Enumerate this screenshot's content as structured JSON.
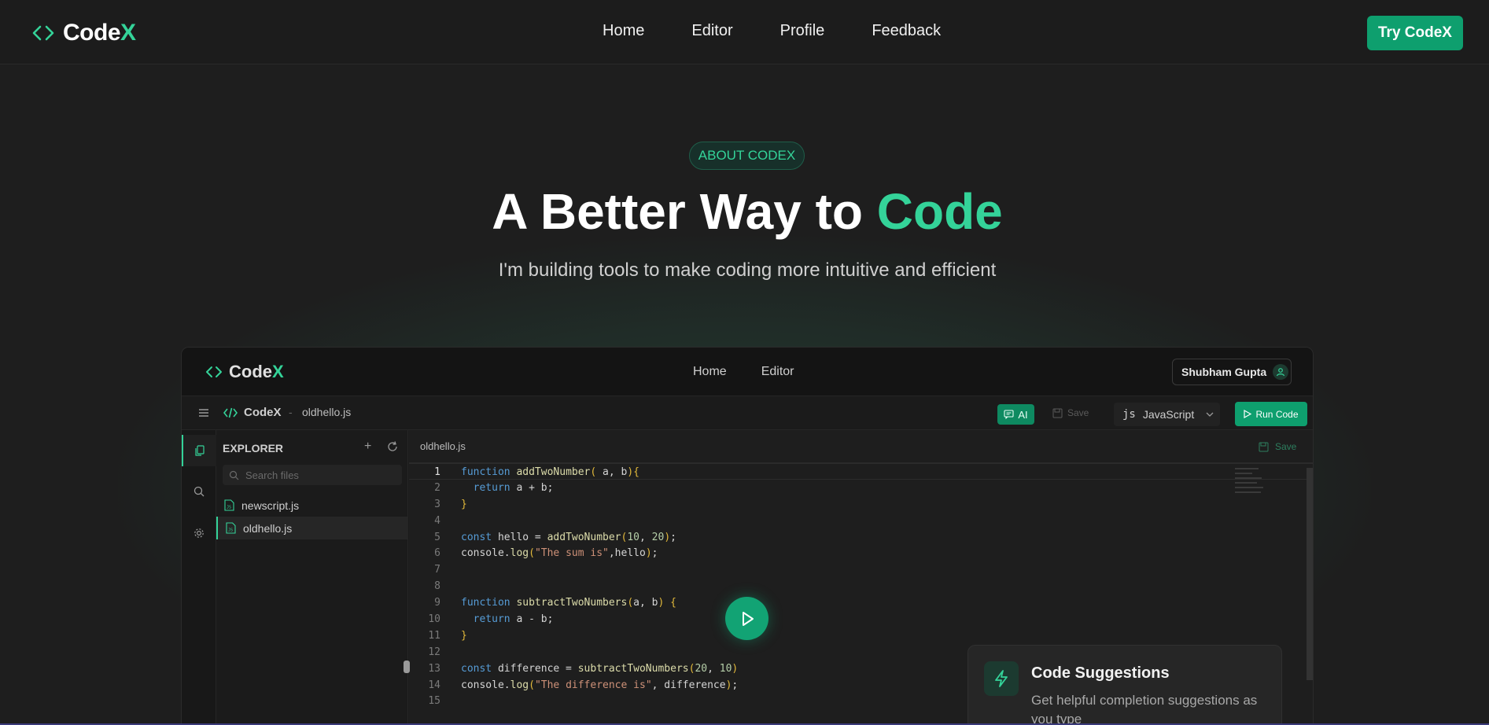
{
  "nav": {
    "brand_prefix": "Code",
    "brand_suffix": "X",
    "links": [
      "Home",
      "Editor",
      "Profile",
      "Feedback"
    ],
    "cta": "Try CodeX"
  },
  "hero": {
    "badge": "ABOUT CODEX",
    "title_main": "A Better Way to ",
    "title_accent": "Code",
    "subtitle": "I'm building tools to make coding more intuitive and efficient"
  },
  "mockup": {
    "nav": {
      "brand_prefix": "Code",
      "brand_suffix": "X",
      "links": [
        "Home",
        "Editor"
      ],
      "user_name": "Shubham Gupta"
    },
    "toolbar": {
      "brand": "CodeX",
      "separator": "-",
      "file": "oldhello.js",
      "ai_label": "AI",
      "save_label": "Save",
      "lang_icon": "js",
      "language": "JavaScript",
      "run_label": "Run Code"
    },
    "explorer": {
      "title": "EXPLORER",
      "search_placeholder": "Search files",
      "files": [
        "newscript.js",
        "oldhello.js"
      ],
      "active_file": "oldhello.js"
    },
    "editor": {
      "tab": "oldhello.js",
      "save_label": "Save",
      "line_numbers": [
        "1",
        "2",
        "3",
        "4",
        "5",
        "6",
        "7",
        "8",
        "9",
        "10",
        "11",
        "12",
        "13",
        "14",
        "15"
      ],
      "code_lines": [
        "function addTwoNumber( a, b){",
        "  return a + b;",
        "}",
        "",
        "const hello = addTwoNumber(10, 20);",
        "console.log(\"The sum is\",hello);",
        "",
        "",
        "function subtractTwoNumbers(a, b) {",
        "  return a - b;",
        "}",
        "",
        "const difference = subtractTwoNumbers(20, 10)",
        "console.log(\"The difference is\", difference);",
        ""
      ]
    }
  },
  "feature_card": {
    "icon": "lightning-icon",
    "title": "Code Suggestions",
    "description": "Get helpful completion suggestions as you type"
  },
  "colors": {
    "accent": "#34d399",
    "button": "#0e9f6e",
    "background": "#1e1e1e"
  }
}
